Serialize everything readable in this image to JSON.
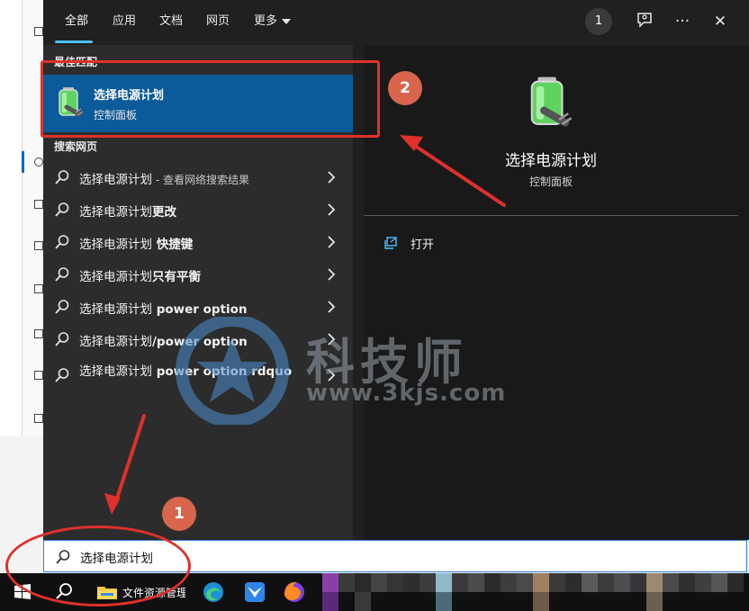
{
  "tabs": [
    {
      "label": "全部",
      "active": true
    },
    {
      "label": "应用",
      "active": false
    },
    {
      "label": "文档",
      "active": false
    },
    {
      "label": "网页",
      "active": false
    },
    {
      "label": "更多",
      "active": false
    }
  ],
  "header": {
    "badge_count": "1",
    "more_symbol": "···",
    "close_symbol": "✕"
  },
  "best_match": {
    "section_label": "最佳匹配",
    "title": "选择电源计划",
    "subtitle": "控制面板"
  },
  "web_search": {
    "section_label": "搜索网页",
    "items": [
      {
        "text": "选择电源计划",
        "suffix": " - 查看网络搜索结果"
      },
      {
        "text": "选择电源计划",
        "bold": "更改"
      },
      {
        "text": "选择电源计划",
        "bold": " 快捷键"
      },
      {
        "text": "选择电源计划",
        "bold": "只有平衡"
      },
      {
        "text": "选择电源计划",
        "bold": " power option"
      },
      {
        "text": "选择电源计划",
        "bold": "/power option"
      },
      {
        "text": "选择电源计划",
        "bold": " power option rdquo"
      }
    ]
  },
  "preview": {
    "title": "选择电源计划",
    "subtitle": "控制面板",
    "actions": [
      {
        "label": "打开"
      }
    ]
  },
  "search": {
    "value": "选择电源计划"
  },
  "taskbar": {
    "explorer_label": "文件资源管理器"
  },
  "annotations": {
    "step1": "1",
    "step2": "2",
    "color": "#e0302c"
  },
  "watermark": {
    "text": "科技师",
    "url": "www.3kjs.com"
  },
  "colors": {
    "panel": "#202020",
    "left_pane": "#2c2c2c",
    "highlight": "#0b5a9a",
    "accent": "#4cc2ff"
  }
}
